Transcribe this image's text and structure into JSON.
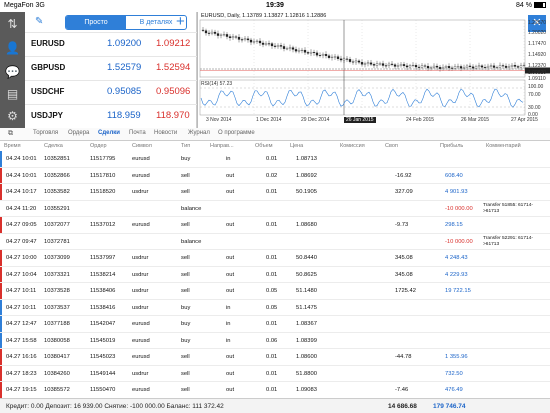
{
  "status": {
    "carrier": "MegaFon",
    "network": "3G",
    "time": "19:39",
    "battery": "84 %",
    "battery_level": 0.84
  },
  "quotes": {
    "tab_simple": "Просто",
    "tab_details": "В деталях",
    "rows": [
      {
        "symbol": "EURUSD",
        "bid": "1.09200",
        "ask": "1.09212"
      },
      {
        "symbol": "GBPUSD",
        "bid": "1.52579",
        "ask": "1.52594"
      },
      {
        "symbol": "USDCHF",
        "bid": "0.95085",
        "ask": "0.95096"
      },
      {
        "symbol": "USDJPY",
        "bid": "118.959",
        "ask": "118.970"
      }
    ]
  },
  "chart": {
    "title": "EURUSD, Daily, 1.13789 1.13827 1.12816 1.12886",
    "rsi_label": "RSI(14) 57.23",
    "price_labels": [
      "1.22570",
      "1.20020",
      "1.17470",
      "1.14920",
      "1.12370",
      "1.09820",
      "1.09110",
      "100.00",
      "70.00",
      "30.00",
      "0.00"
    ],
    "time_labels": [
      "3 Nov 2014",
      "1 Dec 2014",
      "29 Dec 2014",
      "26 Jan 2015",
      "24 Feb 2015",
      "26 Mar 2015",
      "27 Apr 2015"
    ],
    "highlighted_time": "26 Jan 2015",
    "colors": {
      "ask_line": "#d9302c",
      "bid_line": "#444444",
      "rsi": "#2f7fd8",
      "candle": "#222222"
    }
  },
  "tabs": [
    "Торговля",
    "Ордера",
    "Сделки",
    "Почта",
    "Новости",
    "Журнал",
    "О программе"
  ],
  "active_tab": "Сделки",
  "table": {
    "headers": [
      "Время",
      "Сделка",
      "Ордер",
      "Символ",
      "Тип",
      "Направ...",
      "Объем",
      "Цена",
      "Комиссия",
      "Своп",
      "Прибыль",
      "Комментарий"
    ],
    "rows": [
      {
        "time": "04.24 10:01",
        "deal": "10352851",
        "order": "11517795",
        "symbol": "eurusd",
        "type": "buy",
        "dir": "in",
        "vol": "0.01",
        "price": "1.08713",
        "comm": "",
        "swap": "",
        "profit": "",
        "comment": "",
        "accent": "#2f7fd8"
      },
      {
        "time": "04.24 10:01",
        "deal": "10352866",
        "order": "11517810",
        "symbol": "eurusd",
        "type": "sell",
        "dir": "out",
        "vol": "0.02",
        "price": "1.08692",
        "comm": "",
        "swap": "-16.92",
        "profit": "608.40",
        "comment": "",
        "accent": "#d9302c"
      },
      {
        "time": "04.24 10:17",
        "deal": "10353582",
        "order": "11518520",
        "symbol": "usdrur",
        "type": "sell",
        "dir": "out",
        "vol": "0.01",
        "price": "50.1905",
        "comm": "",
        "swap": "327.09",
        "profit": "4 901.93",
        "comment": "",
        "accent": "#d9302c"
      },
      {
        "time": "04.24 11:20",
        "deal": "10355291",
        "order": "",
        "symbol": "",
        "type": "balance",
        "dir": "",
        "vol": "",
        "price": "",
        "comm": "",
        "swap": "",
        "profit": "-10 000.00",
        "comment": "Transfer 51855: 61714->61713",
        "accent": ""
      },
      {
        "time": "04.27 09:05",
        "deal": "10372077",
        "order": "11537012",
        "symbol": "eurusd",
        "type": "sell",
        "dir": "out",
        "vol": "0.01",
        "price": "1.08680",
        "comm": "",
        "swap": "-9.73",
        "profit": "298.15",
        "comment": "",
        "accent": "#d9302c"
      },
      {
        "time": "04.27 09:47",
        "deal": "10372781",
        "order": "",
        "symbol": "",
        "type": "balance",
        "dir": "",
        "vol": "",
        "price": "",
        "comm": "",
        "swap": "",
        "profit": "-10 000.00",
        "comment": "Transfer 52291: 61714->61713",
        "accent": ""
      },
      {
        "time": "04.27 10:00",
        "deal": "10373099",
        "order": "11537997",
        "symbol": "usdrur",
        "type": "sell",
        "dir": "out",
        "vol": "0.01",
        "price": "50.8440",
        "comm": "",
        "swap": "345.08",
        "profit": "4 248.43",
        "comment": "",
        "accent": "#d9302c"
      },
      {
        "time": "04.27 10:04",
        "deal": "10373321",
        "order": "11538214",
        "symbol": "usdrur",
        "type": "sell",
        "dir": "out",
        "vol": "0.01",
        "price": "50.8625",
        "comm": "",
        "swap": "345.08",
        "profit": "4 229.93",
        "comment": "",
        "accent": "#d9302c"
      },
      {
        "time": "04.27 10:11",
        "deal": "10373528",
        "order": "11538406",
        "symbol": "usdrur",
        "type": "sell",
        "dir": "out",
        "vol": "0.05",
        "price": "51.1480",
        "comm": "",
        "swap": "1725.42",
        "profit": "19 722.15",
        "comment": "",
        "accent": "#d9302c"
      },
      {
        "time": "04.27 10:11",
        "deal": "10373537",
        "order": "11538416",
        "symbol": "usdrur",
        "type": "buy",
        "dir": "in",
        "vol": "0.05",
        "price": "51.1475",
        "comm": "",
        "swap": "",
        "profit": "",
        "comment": "",
        "accent": "#2f7fd8"
      },
      {
        "time": "04.27 12:47",
        "deal": "10377188",
        "order": "11542047",
        "symbol": "eurusd",
        "type": "buy",
        "dir": "in",
        "vol": "0.01",
        "price": "1.08367",
        "comm": "",
        "swap": "",
        "profit": "",
        "comment": "",
        "accent": "#2f7fd8"
      },
      {
        "time": "04.27 15:58",
        "deal": "10380058",
        "order": "11545019",
        "symbol": "eurusd",
        "type": "buy",
        "dir": "in",
        "vol": "0.06",
        "price": "1.08399",
        "comm": "",
        "swap": "",
        "profit": "",
        "comment": "",
        "accent": "#2f7fd8"
      },
      {
        "time": "04.27 16:16",
        "deal": "10380417",
        "order": "11545023",
        "symbol": "eurusd",
        "type": "sell",
        "dir": "out",
        "vol": "0.01",
        "price": "1.08600",
        "comm": "",
        "swap": "-44.78",
        "profit": "1 355.96",
        "comment": "",
        "accent": "#d9302c"
      },
      {
        "time": "04.27 18:23",
        "deal": "10384260",
        "order": "11549144",
        "symbol": "usdrur",
        "type": "sell",
        "dir": "out",
        "vol": "0.01",
        "price": "51.8800",
        "comm": "",
        "swap": "",
        "profit": "732.50",
        "comment": "",
        "accent": "#d9302c"
      },
      {
        "time": "04.27 19:15",
        "deal": "10385572",
        "order": "11550470",
        "symbol": "eurusd",
        "type": "sell",
        "dir": "out",
        "vol": "0.01",
        "price": "1.09083",
        "comm": "",
        "swap": "-7.46",
        "profit": "476.49",
        "comment": "",
        "accent": "#d9302c"
      }
    ]
  },
  "footer": {
    "summary": "Кредит: 0.00 Депозит: 16 939.00 Снятие: -100 000.00 Баланс: 111 372.42",
    "swap_total": "14 686.68",
    "profit_total": "179 746.74"
  }
}
